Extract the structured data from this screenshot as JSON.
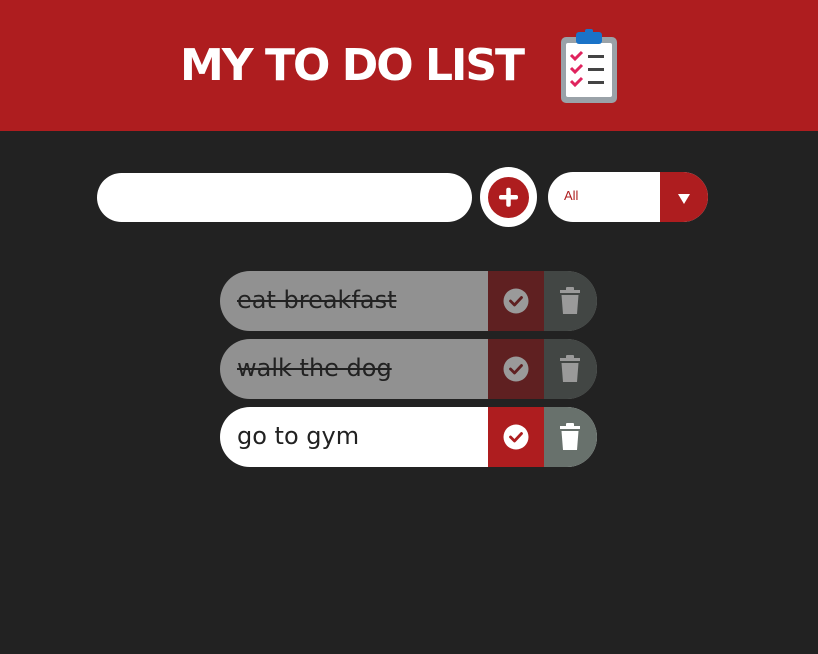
{
  "header": {
    "title": "MY TO DO LIST",
    "icon": "clipboard-checklist-icon"
  },
  "form": {
    "input_value": "",
    "add_icon": "plus-icon",
    "filter_selected": "All",
    "filter_icon": "caret-down-icon"
  },
  "todos": [
    {
      "text": "eat breakfast",
      "completed": true
    },
    {
      "text": "walk the dog",
      "completed": true
    },
    {
      "text": "go to gym",
      "completed": false
    }
  ],
  "colors": {
    "accent": "#ae1d1f",
    "background": "#222222",
    "trash": "#68716c"
  }
}
